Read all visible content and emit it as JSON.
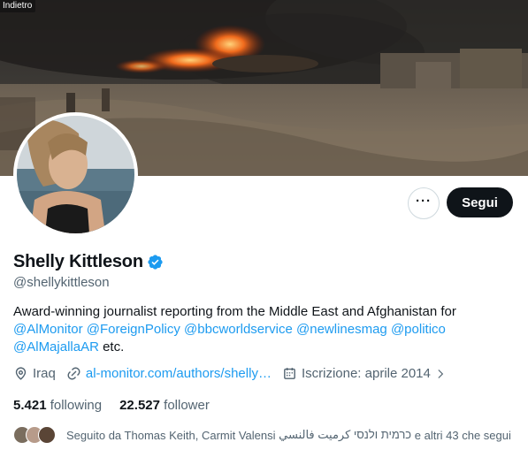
{
  "tooltip": {
    "back": "Indietro"
  },
  "profile": {
    "name": "Shelly Kittleson",
    "handle": "@shellykittleson",
    "verified": true,
    "follow_label": "Segui",
    "more_label": "···"
  },
  "bio": {
    "text_start": "Award-winning journalist reporting from the Middle East and Afghanistan for",
    "mentions": [
      "@AlMonitor",
      "@ForeignPolicy",
      "@bbcworldservice",
      "@newlinesmag",
      "@politico",
      "@AlMajallaAR"
    ],
    "text_end": "etc."
  },
  "meta": {
    "location": "Iraq",
    "website": "al-monitor.com/authors/shelly…",
    "joined": "Iscrizione: aprile 2014"
  },
  "stats": {
    "following_count": "5.421",
    "following_label": "following",
    "followers_count": "22.527",
    "followers_label": "follower"
  },
  "followed_by": {
    "prefix": "Seguito da Thomas Keith, Carmit Valensi",
    "rtl_name": "כרמית ולנסי كرميت فالنسي",
    "suffix": "e altri 43 che segui"
  },
  "colors": {
    "accent": "#1d9bf0",
    "text": "#0f1419",
    "secondary": "#536471",
    "follow_bg": "#0f1419"
  },
  "icons": {
    "location": "map-pin-icon",
    "website": "link-icon",
    "joined": "calendar-icon",
    "verified": "verified-badge-icon"
  }
}
